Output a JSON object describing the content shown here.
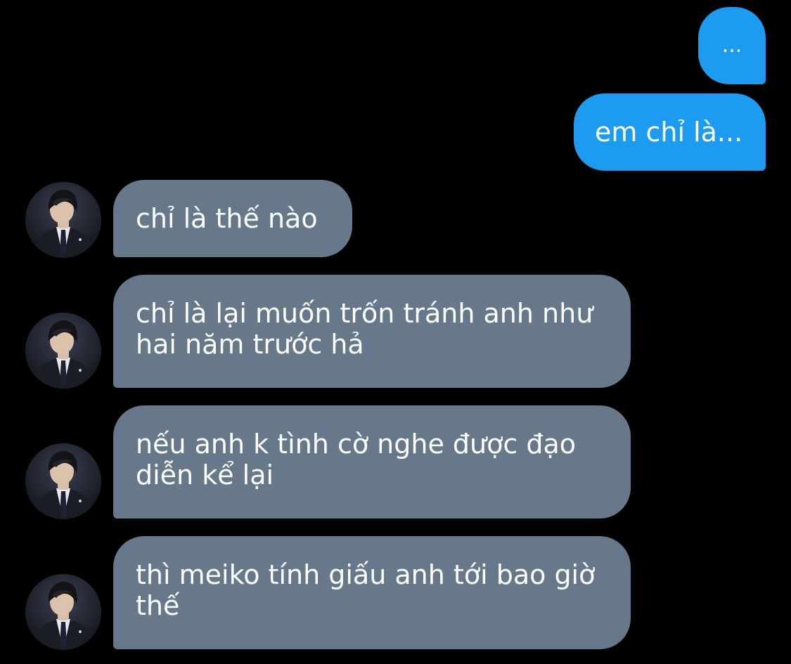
{
  "conversation": {
    "messages": [
      {
        "direction": "sent",
        "text": "..."
      },
      {
        "direction": "sent",
        "text": "em chỉ là..."
      },
      {
        "direction": "received",
        "text": "chỉ là thế nào"
      },
      {
        "direction": "received",
        "text": "chỉ là lại muốn trốn tránh anh như hai năm trước hả"
      },
      {
        "direction": "received",
        "text": "nếu anh k tình cờ nghe được đạo diễn kể lại"
      },
      {
        "direction": "received",
        "text": "thì meiko tính giấu anh tới bao giờ thế"
      }
    ]
  },
  "colors": {
    "background": "#000000",
    "sent_bubble": "#1d9bf0",
    "received_bubble": "#66788a",
    "text": "#ffffff"
  },
  "icons": {
    "avatar": "contact-avatar-photo"
  }
}
